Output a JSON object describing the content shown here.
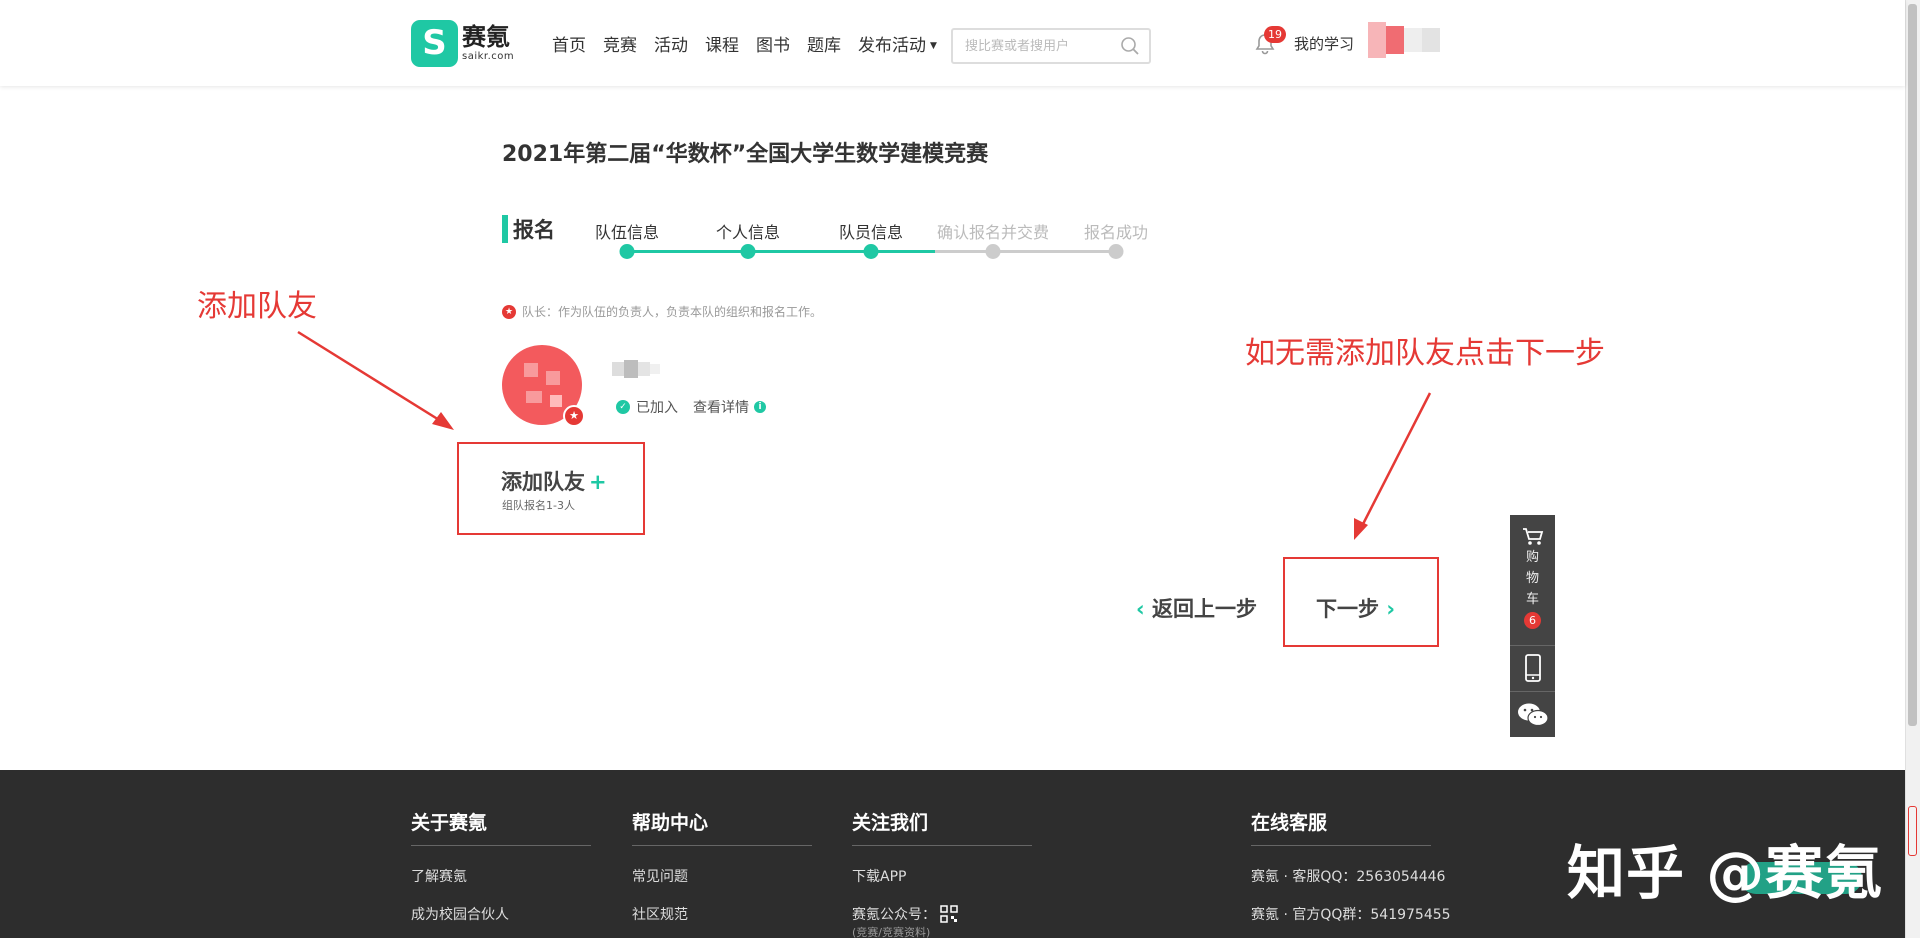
{
  "header": {
    "logo_cn": "赛氪",
    "logo_en": "saikr.com",
    "logo_mark": "S",
    "nav": [
      "首页",
      "竞赛",
      "活动",
      "课程",
      "图书",
      "题库"
    ],
    "publish_label": "发布活动",
    "search_placeholder": "搜比赛或者搜用户",
    "notification_count": "19",
    "my_study": "我的学习"
  },
  "main": {
    "title": "2021年第二届“华数杯”全国大学生数学建模竞赛",
    "section_label": "报名",
    "steps": [
      {
        "label": "队伍信息",
        "state": "done"
      },
      {
        "label": "个人信息",
        "state": "done"
      },
      {
        "label": "队员信息",
        "state": "done"
      },
      {
        "label": "确认报名并交费",
        "state": "todo"
      },
      {
        "label": "报名成功",
        "state": "todo"
      }
    ],
    "notice": "队长：作为队伍的负责人，负责本队的组织和报名工作。",
    "member_status": "已加入",
    "member_detail": "查看详情",
    "add_member_title": "添加队友",
    "add_member_plus": "+",
    "add_member_sub": "组队报名1-3人",
    "back_label": "返回上一步",
    "next_label": "下一步",
    "back_chevron": "‹",
    "next_chevron": "›"
  },
  "annotations": {
    "left": "添加队友",
    "right": "如无需添加队友点击下一步"
  },
  "sidebar": {
    "cart_chars": [
      "购",
      "物",
      "车"
    ],
    "cart_count": "6"
  },
  "footer": {
    "about": {
      "heading": "关于赛氪",
      "links": [
        "了解赛氪",
        "成为校园合伙人"
      ]
    },
    "help": {
      "heading": "帮助中心",
      "links": [
        "常见问题",
        "社区规范"
      ]
    },
    "follow": {
      "heading": "关注我们",
      "links": [
        "下载APP",
        "赛氪公众号："
      ],
      "sub": "(竞赛/竞赛资料)"
    },
    "service": {
      "heading": "在线客服",
      "links": [
        "赛氪 · 客服QQ：2563054446",
        "赛氪 · 官方QQ群：541975455"
      ]
    }
  },
  "watermark": "知乎 @赛氪",
  "colors": {
    "accent": "#1fc8a4",
    "annotation": "#e53935",
    "footer_bg": "#2d2d2d"
  }
}
